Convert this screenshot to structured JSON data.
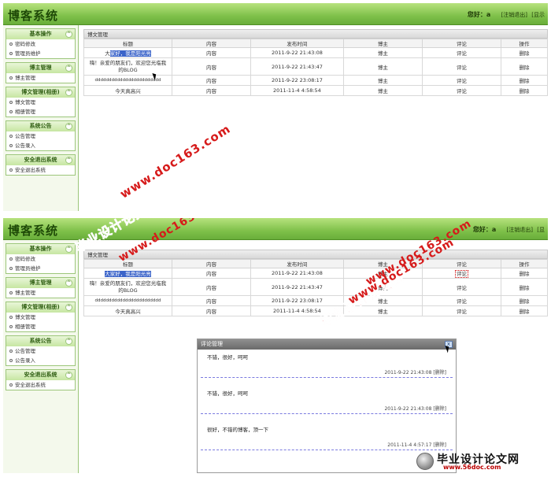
{
  "app": {
    "title": "博客系统",
    "greeting": "您好：a",
    "header_links_top": [
      "[注销退出]",
      "[显示"
    ],
    "header_links_bottom": [
      "[注销退出]",
      "[显"
    ]
  },
  "sidebar": {
    "groups": [
      {
        "title": "基本操作",
        "items": [
          "密码修改",
          "管理员维护"
        ]
      },
      {
        "title": "博主管理",
        "items": [
          "博主管理"
        ]
      },
      {
        "title": "博文管理(相册)",
        "items": [
          "博文管理",
          "相册管理"
        ]
      },
      {
        "title": "系统公告",
        "items": [
          "公告管理",
          "公告录入"
        ]
      },
      {
        "title": "安全退出系统",
        "items": [
          "安全退出系统"
        ]
      }
    ],
    "toggle_glyph": "^"
  },
  "content": {
    "section_title": "博文管理",
    "columns": [
      "标题",
      "内容",
      "发布时间",
      "博主",
      "评论",
      "操作"
    ],
    "rows": [
      {
        "title_a": "大",
        "title_sel": "家好，我是阳光亮",
        "content": "内容",
        "time": "2011-9-22 21:43:08",
        "author": "博主",
        "comment": "评论",
        "action": "删除"
      },
      {
        "title_a": "嗨！亲爱的朋友们，欢迎您光临我",
        "title_b": "的BLOG",
        "content": "内容",
        "time": "2011-9-22 21:43:47",
        "author": "博主",
        "comment": "评论",
        "action": "删除"
      },
      {
        "title_a": "dddddddddddddddddddddddd",
        "content": "内容",
        "time": "2011-9-22 23:08:17",
        "author": "博主",
        "comment": "评论",
        "action": "删除"
      },
      {
        "title_a": "今天真高兴",
        "content": "内容",
        "time": "2011-11-4 4:58:54",
        "author": "博主",
        "comment": "评论",
        "action": "删除"
      }
    ],
    "bottom_row1_title_sel": "大家好，我是阳光亮"
  },
  "dialog": {
    "title": "评论管理",
    "close": "x",
    "comments": [
      {
        "text": "不错，很好，呵呵",
        "time": "2011-9-22 21:43:08",
        "delete": "[删除]"
      },
      {
        "text": "不错，很好，呵呵",
        "time": "2011-9-22 21:43:08",
        "delete": "[删除]"
      },
      {
        "text": "很好，不错的博客，顶一下",
        "time": "2011-11-4 4:57:17",
        "delete": "[删除]"
      }
    ]
  },
  "watermarks": {
    "url": "www.doc163.com",
    "cn": "毕业设计论文网",
    "footer_name": "毕业设计论文网",
    "footer_url": "www.56doc.com"
  },
  "colors": {
    "header_green": "#7fc14a",
    "sidebar_border": "#9cc67a",
    "link_red": "#cc0000",
    "selection_blue": "#3a63c9",
    "watermark_red": "#d61a1a"
  }
}
